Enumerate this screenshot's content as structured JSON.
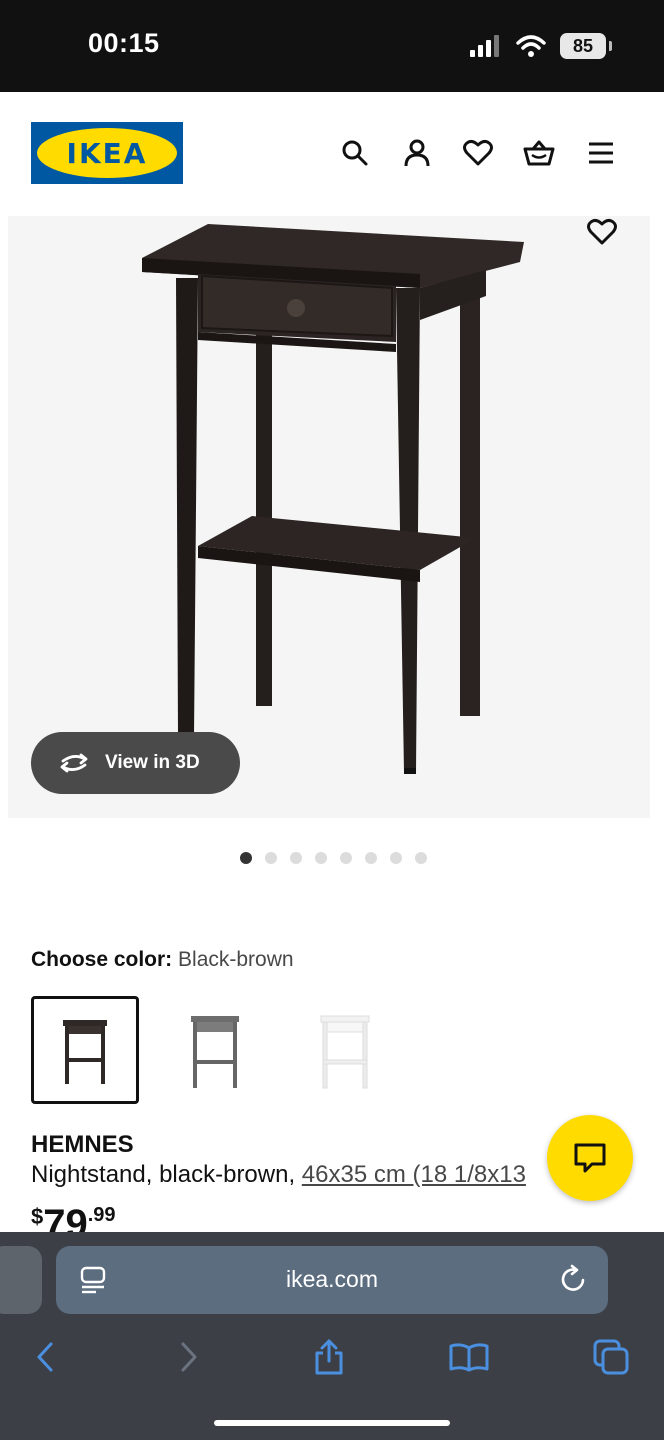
{
  "status_bar": {
    "time": "00:15",
    "battery": "85"
  },
  "header": {
    "logo_text": "IKEA",
    "icons": [
      "search-icon",
      "account-icon",
      "favorites-icon",
      "basket-icon",
      "menu-icon"
    ]
  },
  "gallery": {
    "view_3d_label": "View in 3D",
    "dot_count": 8,
    "active_dot": 0
  },
  "color_chooser": {
    "label": "Choose color:",
    "value": "Black-brown",
    "options": [
      "Black-brown",
      "Gray",
      "White"
    ],
    "colors": [
      "#2e2826",
      "#6d6d6d",
      "#f2f2f2"
    ]
  },
  "product": {
    "name": "HEMNES",
    "description": "Nightstand, black-brown, ",
    "dimensions": "46x35 cm (18 1/8x13",
    "price_currency": "$",
    "price_integer": "79",
    "price_decimal": ".99"
  },
  "browser": {
    "url": "ikea.com"
  },
  "colors": {
    "brand_blue": "#0058a3",
    "brand_yellow": "#ffdb00",
    "browser_accent": "#4a8fe0"
  }
}
